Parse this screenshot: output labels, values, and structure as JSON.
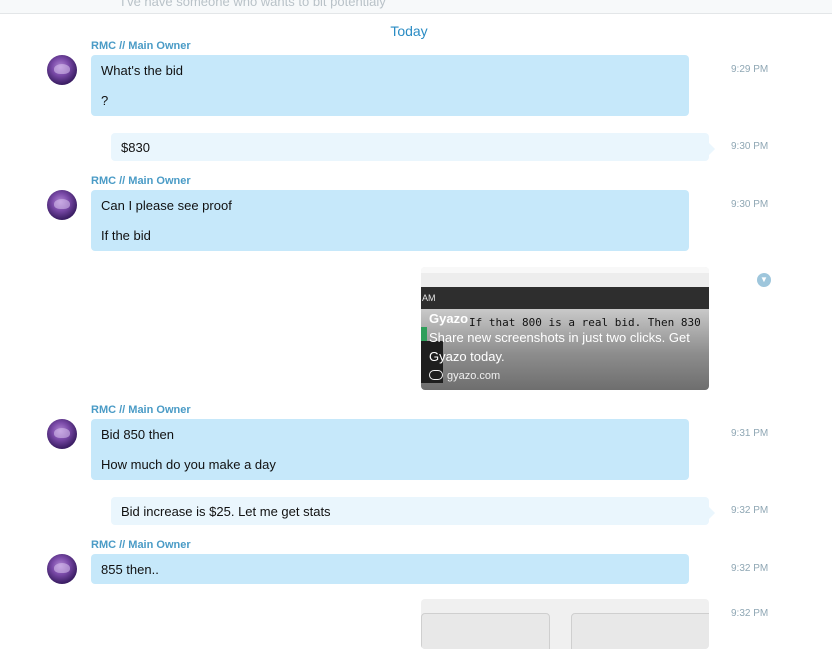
{
  "top_partial_text": "I've have someone who wants to bit potentialy",
  "date_separator": "Today",
  "messages": [
    {
      "sender": "RMC // Main Owner",
      "lines": [
        "What's the bid",
        "?"
      ],
      "time": "9:29 PM"
    },
    {
      "lines": [
        "$830"
      ],
      "time": "9:30 PM"
    },
    {
      "sender": "RMC // Main Owner",
      "lines": [
        "Can I please see proof",
        "If the bid"
      ],
      "time": "9:30 PM"
    },
    {
      "link_card": {
        "timebar_text": "AM",
        "brand": "Gyazo",
        "screenshot_text": "If that 800 is a real bid. Then 830",
        "description": "Share new screenshots in just two clicks. Get Gyazo today.",
        "host": "gyazo.com",
        "menu_icon": "chevron-down-icon"
      }
    },
    {
      "sender": "RMC // Main Owner",
      "lines": [
        "Bid 850 then",
        "How much do you make a day"
      ],
      "time": "9:31 PM"
    },
    {
      "lines": [
        "Bid increase is $25. Let me get stats"
      ],
      "time": "9:32 PM"
    },
    {
      "sender": "RMC // Main Owner",
      "lines": [
        "855 then.."
      ],
      "time": "9:32 PM"
    },
    {
      "time": "9:32 PM"
    }
  ],
  "colors": {
    "incoming_bubble": "#c6e8fa",
    "outgoing_bubble": "#eaf6fd",
    "sender_name": "#4a9bc6",
    "accent": "#2a8cc4",
    "timestamp": "#8fa7b4"
  }
}
